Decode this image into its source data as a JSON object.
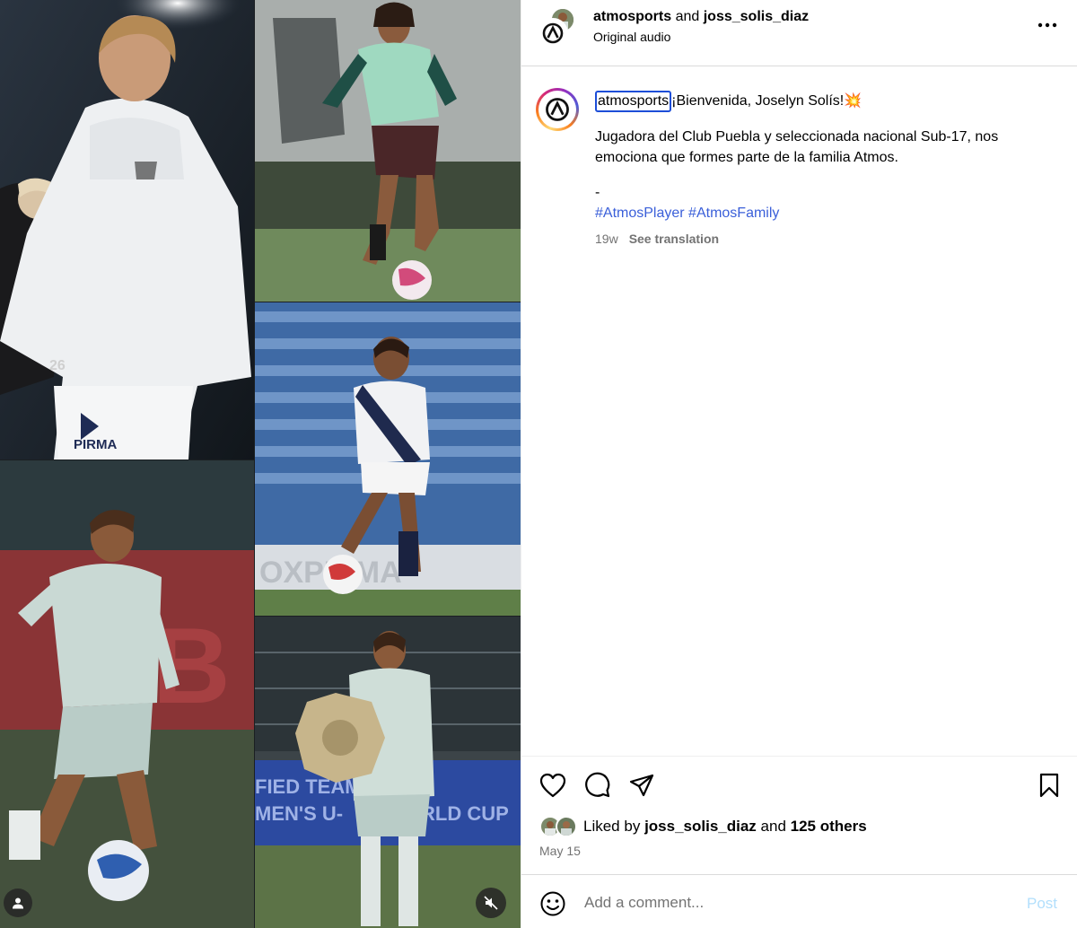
{
  "header": {
    "author_primary": "atmosports",
    "conjunction": "and",
    "author_secondary": "joss_solis_diaz",
    "audio_label": "Original audio",
    "more_icon": "more-horizontal-icon"
  },
  "caption": {
    "username": "atmosports",
    "headline": "¡Bienvenida, Joselyn Solís!",
    "headline_emoji": "💥",
    "paragraph": "Jugadora del Club Puebla y seleccionada nacional Sub-17, nos emociona que formes parte de la familia Atmos.",
    "dash": "-",
    "hashtags": [
      "#AtmosPlayer",
      "#AtmosFamily"
    ],
    "age": "19w",
    "see_translation": "See translation"
  },
  "media": {
    "tiles": [
      {
        "id": "white-jacket-player"
      },
      {
        "id": "training-player-green-shirt"
      },
      {
        "id": "puebla-player-with-ball"
      },
      {
        "id": "mexico-player-dribbling"
      },
      {
        "id": "player-holding-plaque"
      }
    ],
    "board_text_1": "FIED TEAM",
    "board_text_2": "MEN'S U-",
    "board_text_3": "RLD CUP",
    "sponsor_text": "PIRMA",
    "jersey_number": "26"
  },
  "actions": {
    "icons": [
      "heart-icon",
      "comment-icon",
      "share-icon",
      "bookmark-icon"
    ],
    "liked_by_prefix": "Liked by",
    "liked_by_user": "joss_solis_diaz",
    "liked_by_and": "and",
    "liked_by_others": "125 others",
    "date": "May 15"
  },
  "comment": {
    "placeholder": "Add a comment...",
    "post_label": "Post"
  },
  "colors": {
    "link_blue": "#3a5fd9",
    "post_disabled": "#b2dffc",
    "muted_text": "#737373",
    "divider": "#dbdbdb"
  }
}
